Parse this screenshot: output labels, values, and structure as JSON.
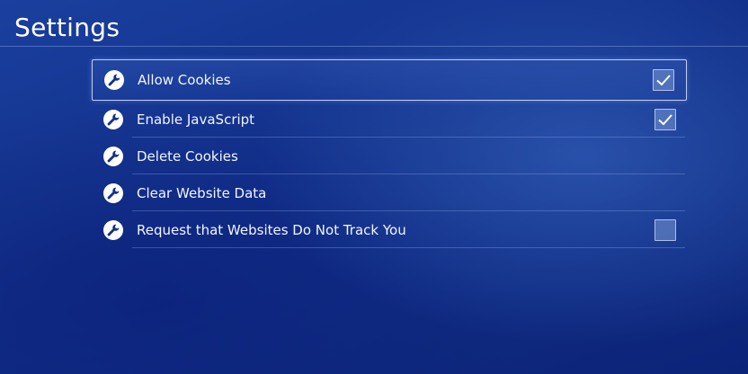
{
  "header": {
    "title": "Settings"
  },
  "settings": [
    {
      "label": "Allow Cookies",
      "icon": "wrench-icon",
      "has_checkbox": true,
      "checked": true,
      "selected": true
    },
    {
      "label": "Enable JavaScript",
      "icon": "wrench-icon",
      "has_checkbox": true,
      "checked": true,
      "selected": false
    },
    {
      "label": "Delete Cookies",
      "icon": "wrench-icon",
      "has_checkbox": false,
      "checked": false,
      "selected": false
    },
    {
      "label": "Clear Website Data",
      "icon": "wrench-icon",
      "has_checkbox": false,
      "checked": false,
      "selected": false
    },
    {
      "label": "Request that Websites Do Not Track You",
      "icon": "wrench-icon",
      "has_checkbox": true,
      "checked": false,
      "selected": false
    }
  ],
  "colors": {
    "background": "#12308a",
    "text": "#ffffff",
    "checkbox_fill": "#7896d2"
  }
}
